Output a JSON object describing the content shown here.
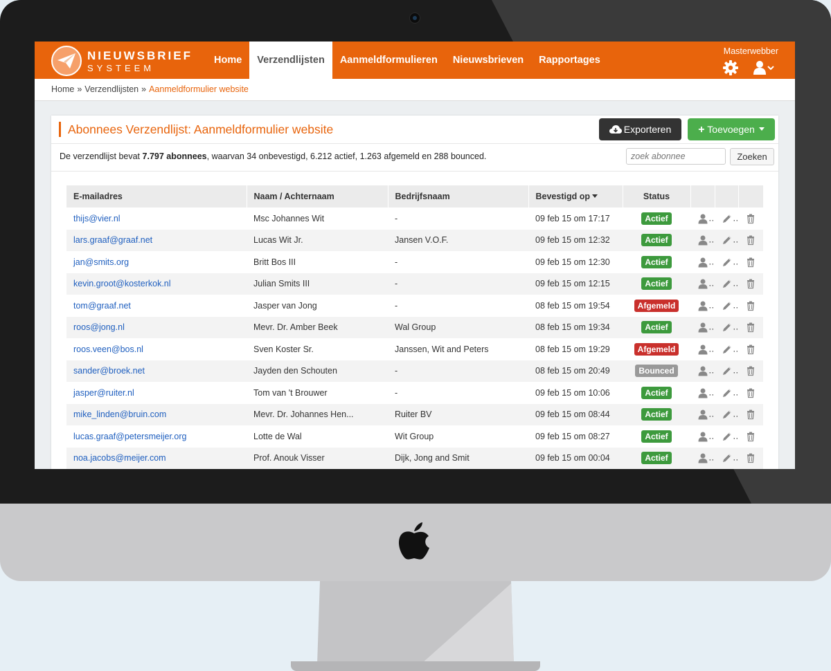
{
  "app": {
    "brand_line1": "NIEUWSBRIEF",
    "brand_line2": "SYSTEEM",
    "nav": [
      {
        "label": "Home",
        "active": false
      },
      {
        "label": "Verzendlijsten",
        "active": true
      },
      {
        "label": "Aanmeldformulieren",
        "active": false
      },
      {
        "label": "Nieuwsbrieven",
        "active": false
      },
      {
        "label": "Rapportages",
        "active": false
      }
    ],
    "user": "Masterwebber",
    "accent_color": "#e8640c"
  },
  "breadcrumb": {
    "items": [
      "Home",
      "Verzendlijsten"
    ],
    "separator": "»",
    "current": "Aanmeldformulier website"
  },
  "panel": {
    "title": "Abonnees Verzendlijst: Aanmeldformulier website",
    "export_label": "Exporteren",
    "add_label": "Toevoegen",
    "summary_prefix": "De verzendlijst bevat ",
    "summary_bold": "7.797 abonnees",
    "summary_suffix": ", waarvan 34 onbevestigd, 6.212 actief, 1.263 afgemeld en 288 bounced.",
    "search_placeholder": "zoek abonnee",
    "search_button": "Zoeken"
  },
  "table": {
    "columns": {
      "email": "E-mailadres",
      "name": "Naam / Achternaam",
      "company": "Bedrijfsnaam",
      "confirmed": "Bevestigd op",
      "status": "Status"
    },
    "sorted_column": "confirmed",
    "sort_icon": "caret-down-icon",
    "status_colors": {
      "Actief": "#3d9a3d",
      "Afgemeld": "#c9302c",
      "Bounced": "#999999"
    },
    "row_icons": [
      "user-icon",
      "pencil-icon",
      "trash-icon"
    ],
    "rows": [
      {
        "email": "thijs@vier.nl",
        "name": "Msc Johannes Wit",
        "company": "-",
        "confirmed": "09 feb 15 om 17:17",
        "status": "Actief"
      },
      {
        "email": "lars.graaf@graaf.net",
        "name": "Lucas Wit Jr.",
        "company": "Jansen V.O.F.",
        "confirmed": "09 feb 15 om 12:32",
        "status": "Actief"
      },
      {
        "email": "jan@smits.org",
        "name": "Britt Bos III",
        "company": "-",
        "confirmed": "09 feb 15 om 12:30",
        "status": "Actief"
      },
      {
        "email": "kevin.groot@kosterkok.nl",
        "name": "Julian Smits III",
        "company": "-",
        "confirmed": "09 feb 15 om 12:15",
        "status": "Actief"
      },
      {
        "email": "tom@graaf.net",
        "name": "Jasper van Jong",
        "company": "-",
        "confirmed": "08 feb 15 om 19:54",
        "status": "Afgemeld"
      },
      {
        "email": "roos@jong.nl",
        "name": "Mevr. Dr. Amber Beek",
        "company": "Wal Group",
        "confirmed": "08 feb 15 om 19:34",
        "status": "Actief"
      },
      {
        "email": "roos.veen@bos.nl",
        "name": "Sven Koster Sr.",
        "company": "Janssen, Wit and Peters",
        "confirmed": "08 feb 15 om 19:29",
        "status": "Afgemeld"
      },
      {
        "email": "sander@broek.net",
        "name": "Jayden den Schouten",
        "company": "-",
        "confirmed": "08 feb 15 om 20:49",
        "status": "Bounced"
      },
      {
        "email": "jasper@ruiter.nl",
        "name": "Tom van 't Brouwer",
        "company": "-",
        "confirmed": "09 feb 15 om 10:06",
        "status": "Actief"
      },
      {
        "email": "mike_linden@bruin.com",
        "name": "Mevr. Dr. Johannes Hen...",
        "company": "Ruiter BV",
        "confirmed": "09 feb 15 om 08:44",
        "status": "Actief"
      },
      {
        "email": "lucas.graaf@petersmeijer.org",
        "name": "Lotte de Wal",
        "company": "Wit Group",
        "confirmed": "09 feb 15 om 08:27",
        "status": "Actief"
      },
      {
        "email": "noa.jacobs@meijer.com",
        "name": "Prof. Anouk Visser",
        "company": "Dijk, Jong and Smit",
        "confirmed": "09 feb 15 om 00:04",
        "status": "Actief"
      }
    ]
  }
}
